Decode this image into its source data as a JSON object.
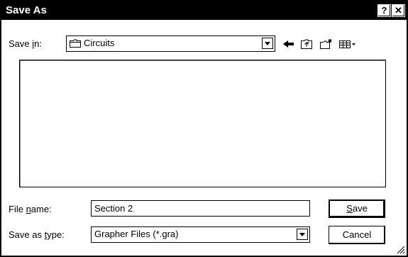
{
  "dialog": {
    "title": "Save As",
    "help_glyph": "?",
    "close_glyph": "✕"
  },
  "save_in": {
    "label_pre": "Save ",
    "label_accel": "i",
    "label_post": "n:",
    "value": "Circuits",
    "folder_icon": "folder-icon"
  },
  "toolbar": {
    "icons": [
      "back-arrow-icon",
      "up-one-level-icon",
      "new-folder-icon",
      "view-menu-icon"
    ]
  },
  "file_list": {
    "items": []
  },
  "file_name": {
    "label_pre": "File ",
    "label_accel": "n",
    "label_post": "ame:",
    "value": "Section 2"
  },
  "save_as_type": {
    "label_pre": "Save as ",
    "label_accel": "t",
    "label_post": "ype:",
    "value": "Grapher Files (*.gra)"
  },
  "buttons": {
    "save_accel": "S",
    "save_rest": "ave",
    "cancel": "Cancel"
  },
  "colors": {
    "titlebar": "#000000",
    "background": "#ffffff"
  }
}
